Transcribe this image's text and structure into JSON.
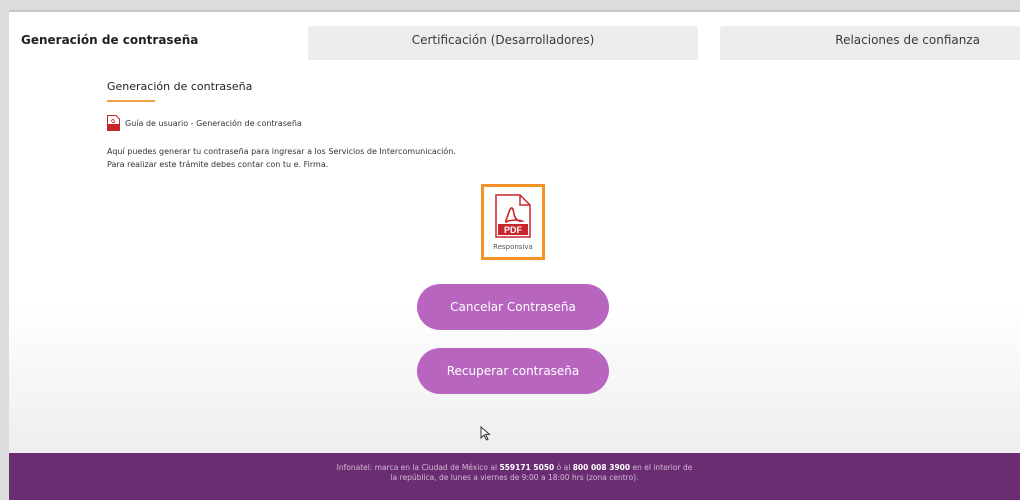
{
  "tabs": [
    {
      "label": "Generación de contraseña"
    },
    {
      "label": "Certificación (Desarrolladores)"
    },
    {
      "label": "Relaciones de confianza"
    }
  ],
  "section": {
    "title": "Generación de contraseña",
    "guide_link": "Guía de usuario - Generación de contraseña",
    "desc_line1": "Aquí puedes generar tu contraseña para ingresar a los Servicios de Intercomunicación.",
    "desc_line2": "Para realizar este trámite debes contar con tu e. Firma."
  },
  "responsiva": {
    "icon": "pdf-icon",
    "label": "Responsiva"
  },
  "buttons": {
    "cancel": "Cancelar Contraseña",
    "recover": "Recuperar contraseña"
  },
  "footer": {
    "part1": "Infonatel: marca en la Ciudad de México al ",
    "phone1": "559171 5050",
    "part2": " ó al ",
    "phone2": "800 008 3900",
    "part3": " en el interior de la república, de lunes a viernes de 9:00 a 18:00 hrs (zona centro)."
  },
  "colors": {
    "accent_orange": "#f39227",
    "button_purple": "#b865c0",
    "footer_purple": "#6b2d72",
    "pdf_red": "#c9252c"
  }
}
